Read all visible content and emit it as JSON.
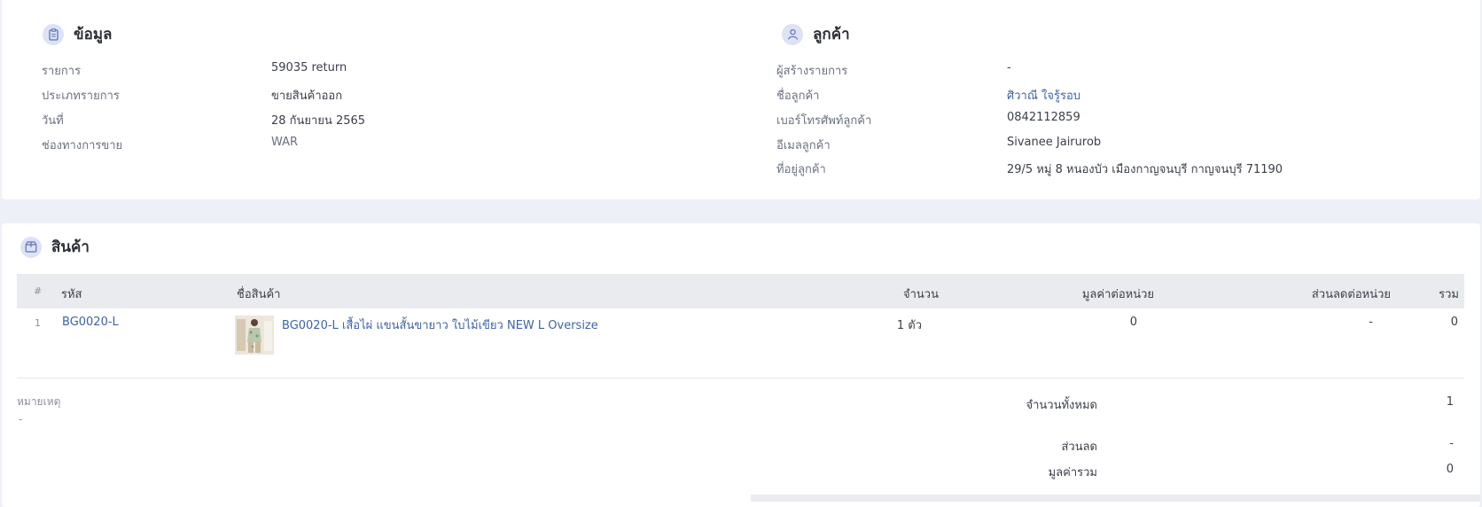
{
  "info": {
    "title": "ข้อมูล",
    "fields": [
      {
        "label": "รายการ",
        "value": "59035 return"
      },
      {
        "label": "ประเภทรายการ",
        "value": "ขายสินค้าออก"
      },
      {
        "label": "วันที่",
        "value": "28 กันยายน 2565"
      },
      {
        "label": "ช่องทางการขาย",
        "value": "WAR"
      }
    ]
  },
  "customer": {
    "title": "ลูกค้า",
    "fields": [
      {
        "label": "ผู้สร้างรายการ",
        "value": "-"
      },
      {
        "label": "ชื่อลูกค้า",
        "value": "ศิวาณี ใจรู้รอบ"
      },
      {
        "label": "เบอร์โทรศัพท์ลูกค้า",
        "value": "0842112859"
      },
      {
        "label": "อีเมลลูกค้า",
        "value": "Sivanee Jairurob"
      },
      {
        "label": "ที่อยู่ลูกค้า",
        "value": "29/5 หมู่ 8 หนองบัว เมืองกาญจนบุรี กาญจนบุรี 71190"
      }
    ]
  },
  "products": {
    "title": "สินค้า",
    "columns": {
      "index": "#",
      "code": "รหัส",
      "name": "ชื่อสินค้า",
      "qty": "จำนวน",
      "unit_price": "มูลค่าต่อหน่วย",
      "unit_discount": "ส่วนลดต่อหน่วย",
      "total": "รวม"
    },
    "rows": [
      {
        "index": "1",
        "code": "BG0020-L",
        "name": "BG0020-L เสื้อไผ่ แขนสั้นขายาว ใบไม้เขียว NEW L Oversize",
        "qty": "1 ตัว",
        "unit_price": "0",
        "unit_discount": "-",
        "total": "0"
      }
    ]
  },
  "note": {
    "label": "หมายเหตุ",
    "value": "-"
  },
  "summary": {
    "total_qty_label": "จำนวนทั้งหมด",
    "total_qty_value": "1",
    "discount_label": "ส่วนลด",
    "discount_value": "-",
    "grand_total_label": "มูลค่ารวม",
    "grand_total_value": "0"
  },
  "colors": {
    "accent": "#3e63a8",
    "icon_bg": "#dde2f5",
    "page_bg": "#eef0f8"
  }
}
